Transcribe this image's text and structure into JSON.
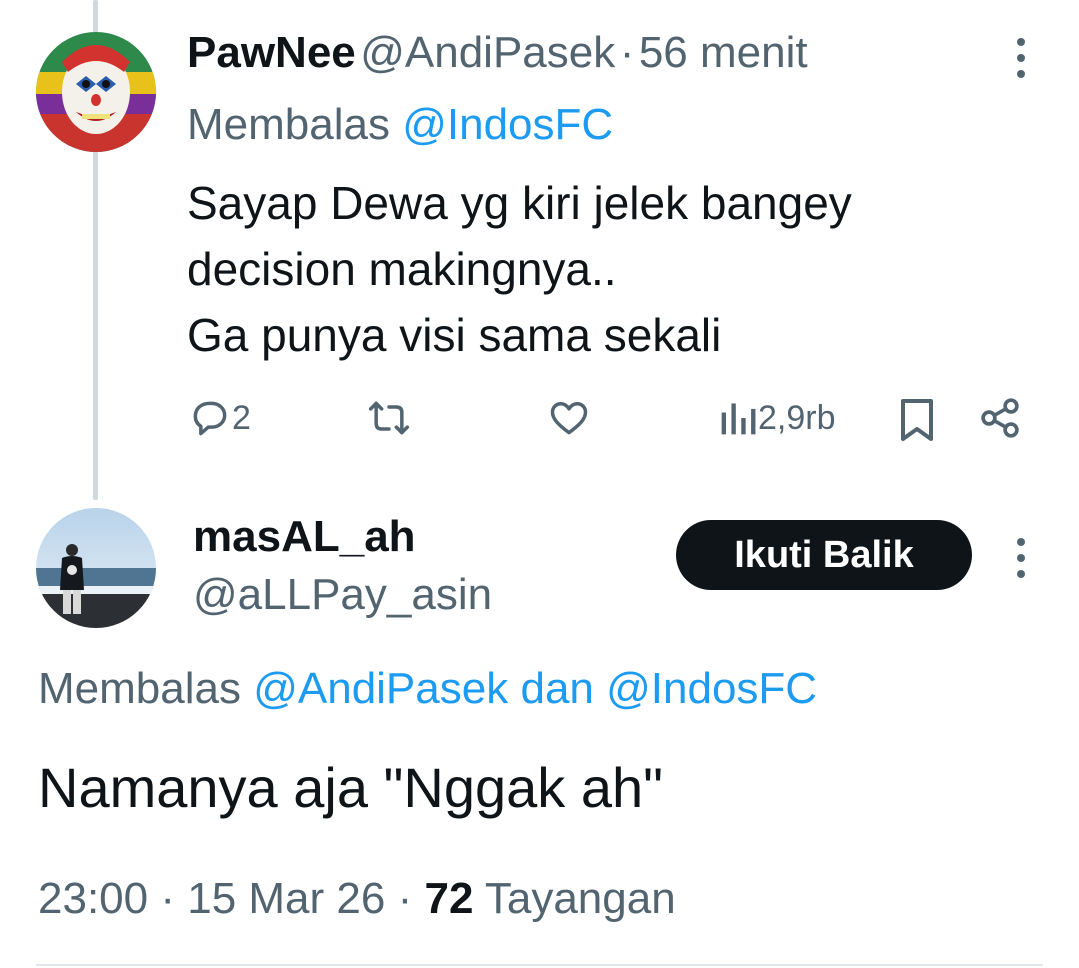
{
  "reply_tweet": {
    "display_name": "PawNee",
    "handle": "@AndiPasek",
    "separator": "·",
    "time_ago": "56 menit",
    "replying_prefix": "Membalas",
    "replying_to": "@IndosFC",
    "text_lines": [
      "Sayap Dewa yg kiri jelek bangey",
      "decision makingnya..",
      "Ga punya visi sama sekali"
    ],
    "actions": {
      "reply_count": "2",
      "views_count": "2,9rb"
    }
  },
  "main_tweet": {
    "display_name": "masAL_ah",
    "handle": "@aLLPay_asin",
    "follow_label": "Ikuti Balik",
    "replying_prefix": "Membalas",
    "replying_to_1": "@AndiPasek",
    "replying_conj": "dan",
    "replying_to_2": "@IndosFC",
    "text": "Namanya aja \"Nggak ah\"",
    "meta": {
      "time": "23:00",
      "separator": "·",
      "date": "15 Mar 26",
      "views_count": "72",
      "views_label": "Tayangan"
    }
  },
  "colors": {
    "text": "#0f1419",
    "muted": "#536471",
    "link": "#1d9bf0",
    "button_bg": "#0f1419"
  },
  "icons": [
    "reply-icon",
    "retweet-icon",
    "like-icon",
    "views-icon",
    "bookmark-icon",
    "share-icon",
    "more-icon"
  ]
}
